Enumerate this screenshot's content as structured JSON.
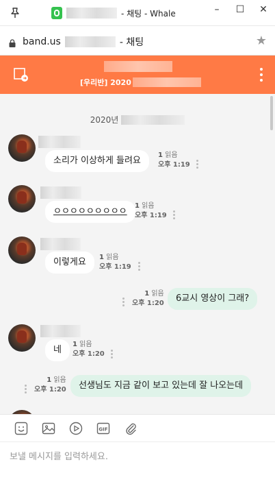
{
  "window": {
    "title": "- 채팅 - Whale",
    "minimize_glyph": "–",
    "maximize_glyph": "☐",
    "close_glyph": "✕"
  },
  "address": {
    "domain": "band.us",
    "suffix": "- 채팅"
  },
  "chat_header": {
    "subtitle": "[우리반] 2020"
  },
  "date_divider": "2020년",
  "messages": [
    {
      "text": "소리가 이상하게 들려요",
      "read": "1",
      "read_label": "읽음",
      "time": "오후 1:19",
      "mine": false
    },
    {
      "text": "ㅇㅇㅇㅇㅇㅇㅇㅇㅇ",
      "read": "1",
      "read_label": "읽음",
      "time": "오후 1:19",
      "mine": false
    },
    {
      "text": "이렇게요",
      "read": "1",
      "read_label": "읽음",
      "time": "오후 1:19",
      "mine": false
    },
    {
      "text": "6교시 영상이 그래?",
      "read": "1",
      "read_label": "읽음",
      "time": "오후 1:20",
      "mine": true
    },
    {
      "text": "네",
      "read": "1",
      "read_label": "읽음",
      "time": "오후 1:20",
      "mine": false
    },
    {
      "text": "선생님도 지금 같이 보고 있는데 잘 나오는데",
      "read": "1",
      "read_label": "읽음",
      "time": "오후 1:20",
      "mine": true
    }
  ],
  "toolbar": {
    "items": [
      "emoticon-icon",
      "image-icon",
      "video-icon",
      "gif-icon",
      "attach-icon"
    ],
    "gif_label": "GIF"
  },
  "input": {
    "placeholder": "보낼 메시지를 입력하세요.",
    "value": ""
  },
  "colors": {
    "header": "#ff7a45",
    "mine_bubble": "#dff3e9",
    "other_bubble": "#ffffff",
    "chat_bg": "#f4f4f4"
  }
}
